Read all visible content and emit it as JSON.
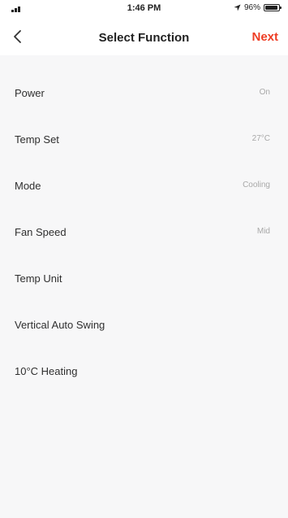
{
  "status_bar": {
    "time": "1:46 PM",
    "battery": "96%"
  },
  "nav": {
    "title": "Select Function",
    "next_label": "Next"
  },
  "functions": [
    {
      "label": "Power",
      "value": "On"
    },
    {
      "label": "Temp Set",
      "value": "27°C"
    },
    {
      "label": "Mode",
      "value": "Cooling"
    },
    {
      "label": "Fan Speed",
      "value": "Mid"
    },
    {
      "label": "Temp Unit",
      "value": ""
    },
    {
      "label": "Vertical Auto Swing",
      "value": ""
    },
    {
      "label": "10°C Heating",
      "value": ""
    }
  ],
  "colors": {
    "accent": "#ee3d24",
    "background": "#f7f7f8",
    "value_text": "#a8a8a8"
  }
}
